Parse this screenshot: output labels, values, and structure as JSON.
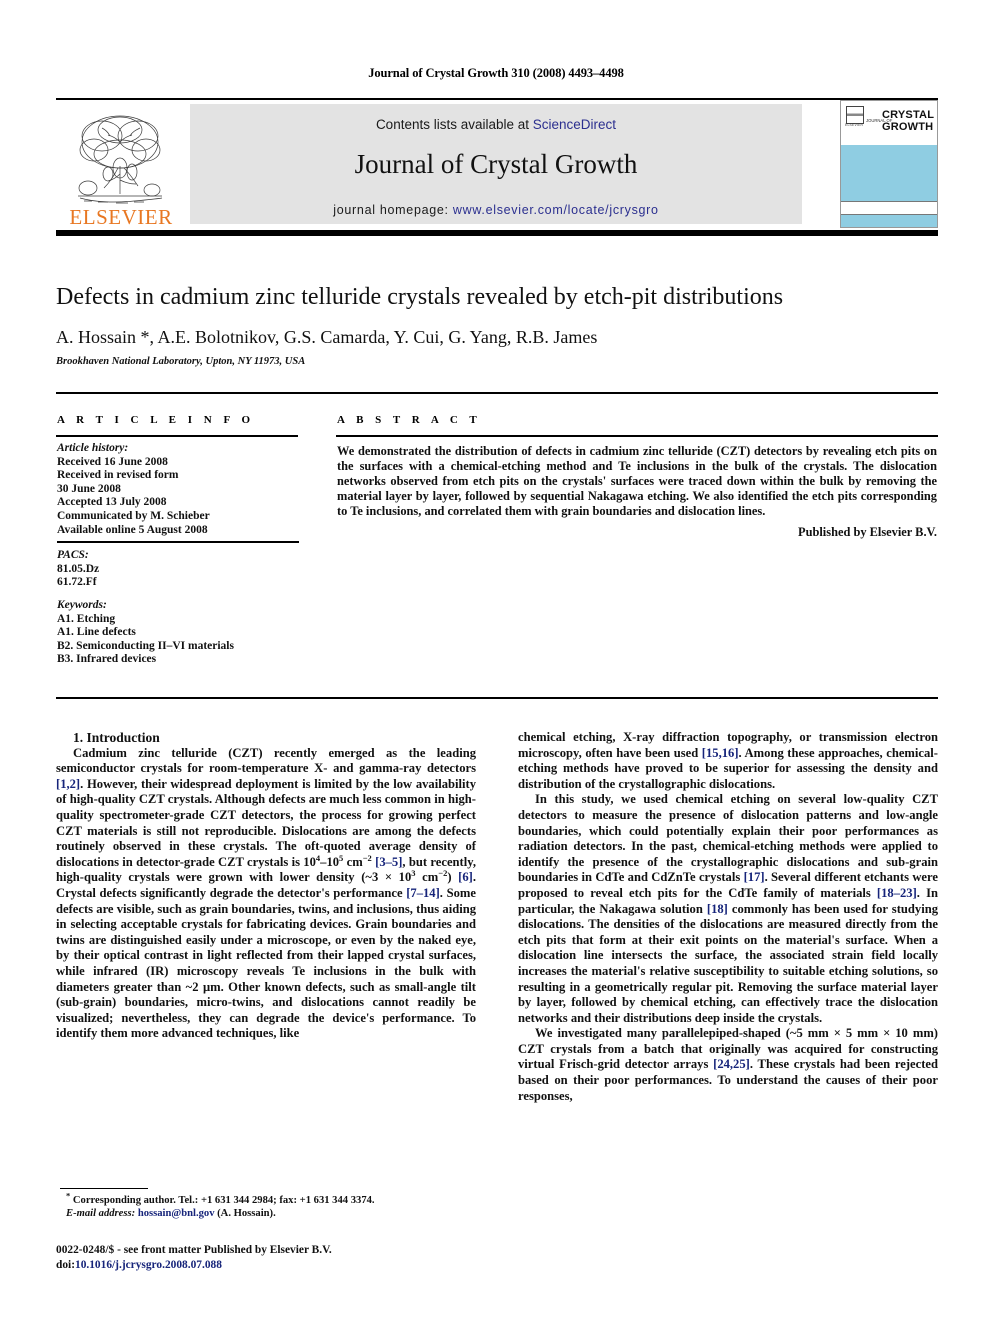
{
  "running_head": "Journal of Crystal Growth 310 (2008) 4493–4498",
  "masthead": {
    "contents_prefix": "Contents lists available at ",
    "contents_link": "ScienceDirect",
    "journal_title": "Journal of Crystal Growth",
    "homepage_prefix": "journal homepage: ",
    "homepage_url": "www.elsevier.com/locate/jcrysgro",
    "publisher_wordmark": "ELSEVIER",
    "cover": {
      "pre_title": "JOURNAL OF",
      "title_line1": "CRYSTAL",
      "title_line2": "GROWTH",
      "mini_caption": "ELSEVIER",
      "band_color": "#8fcde2"
    }
  },
  "article": {
    "title": "Defects in cadmium zinc telluride crystals revealed by etch-pit distributions",
    "authors": "A. Hossain *, A.E. Bolotnikov, G.S. Camarda, Y. Cui, G. Yang, R.B. James",
    "affiliation": "Brookhaven National Laboratory, Upton, NY 11973, USA"
  },
  "info": {
    "heading": "A R T I C L E  I N F O",
    "history_label": "Article history:",
    "history": [
      "Received 16 June 2008",
      "Received in revised form",
      "30 June 2008",
      "Accepted 13 July 2008",
      "Communicated by M. Schieber",
      "Available online 5 August 2008"
    ],
    "pacs_label": "PACS:",
    "pacs": [
      "81.05.Dz",
      "61.72.Ff"
    ],
    "keywords_label": "Keywords:",
    "keywords": [
      "A1. Etching",
      "A1. Line defects",
      "B2. Semiconducting II–VI materials",
      "B3. Infrared devices"
    ]
  },
  "abstract": {
    "heading": "A B S T R A C T",
    "body": "We demonstrated the distribution of defects in cadmium zinc telluride (CZT) detectors by revealing etch pits on the surfaces with a chemical-etching method and Te inclusions in the bulk of the crystals. The dislocation networks observed from etch pits on the crystals' surfaces were traced down within the bulk by removing the material layer by layer, followed by sequential Nakagawa etching. We also identified the etch pits corresponding to Te inclusions, and correlated them with grain boundaries and dislocation lines.",
    "publisher_note": "Published by Elsevier B.V."
  },
  "body": {
    "section_number_title": "1.  Introduction",
    "left_paragraph_1_parts": {
      "t1": "Cadmium zinc telluride (CZT) recently emerged as the leading semiconductor crystals for room-temperature X- and gamma-ray detectors ",
      "r1": "[1,2]",
      "t2": ". However, their widespread deployment is limited by the low availability of high-quality CZT crystals. Although defects are much less common in high-quality spectrometer-grade CZT detectors, the process for growing perfect CZT materials is still not reproducible. Dislocations are among the defects routinely observed in these crystals. The oft-quoted average density of dislocations in detector-grade CZT crystals is 10",
      "sup1": "4",
      "t3": "–10",
      "sup2": "5",
      "t4": " cm",
      "sup3": "−2",
      "t5": " ",
      "r2": "[3–5]",
      "t6": ", but recently, high-quality crystals were grown with lower density (~3 × 10",
      "sup4": "3",
      "t7": " cm",
      "sup5": "−2",
      "t8": ") ",
      "r3": "[6]",
      "t9": ". Crystal defects significantly degrade the detector's performance ",
      "r4": "[7–14]",
      "t10": ". Some defects are visible, such as grain boundaries, twins, and inclusions, thus aiding in selecting acceptable crystals for fabricating devices. Grain boundaries and twins are distinguished easily under a microscope, or even by the naked eye, by their optical contrast in light reflected from their lapped crystal surfaces, while infrared (IR) microscopy reveals Te inclusions in the bulk with diameters greater than ~2 μm. Other known defects, such as small-angle tilt (sub-grain) boundaries, micro-twins, and dislocations cannot readily be visualized; nevertheless, they can degrade the device's performance. To identify them more advanced techniques, like"
    },
    "right_paragraph_1_parts": {
      "t1": "chemical etching, X-ray diffraction topography, or transmission electron microscopy, often have been used ",
      "r1": "[15,16]",
      "t2": ". Among these approaches, chemical-etching methods have proved to be superior for assessing the density and distribution of the crystallographic dislocations."
    },
    "right_paragraph_2_parts": {
      "t1": "In this study, we used chemical etching on several low-quality CZT detectors to measure the presence of dislocation patterns and low-angle boundaries, which could potentially explain their poor performances as radiation detectors. In the past, chemical-etching methods were applied to identify the presence of the crystallographic dislocations and sub-grain boundaries in CdTe and CdZnTe crystals ",
      "r1": "[17]",
      "t2": ". Several different etchants were proposed to reveal etch pits for the CdTe family of materials ",
      "r2": "[18–23]",
      "t3": ". In particular, the Nakagawa solution ",
      "r3": "[18]",
      "t4": " commonly has been used for studying dislocations. The densities of the dislocations are measured directly from the etch pits that form at their exit points on the material's surface. When a dislocation line intersects the surface, the associated strain field locally increases the material's relative susceptibility to suitable etching solutions, so resulting in a geometrically regular pit. Removing the surface material layer by layer, followed by chemical etching, can effectively trace the dislocation networks and their distributions deep inside the crystals."
    },
    "right_paragraph_3_parts": {
      "t1": "We investigated many parallelepiped-shaped (~5 mm × 5 mm × 10 mm) CZT crystals from a batch that originally was acquired for constructing virtual Frisch-grid detector arrays ",
      "r1": "[24,25]",
      "t2": ". These crystals had been rejected based on their poor performances. To understand the causes of their poor responses,"
    }
  },
  "footnote": {
    "marker": "*",
    "corresponding": " Corresponding author. Tel.: +1 631 344 2984; fax: +1 631 344 3374.",
    "email_label": "E-mail address:",
    "email": "hossain@bnl.gov",
    "email_owner": "(A. Hossain)."
  },
  "imprint": {
    "line1": "0022-0248/$ - see front matter Published by Elsevier B.V.",
    "doi_label": "doi:",
    "doi": "10.1016/j.jcrysgro.2008.07.088"
  }
}
